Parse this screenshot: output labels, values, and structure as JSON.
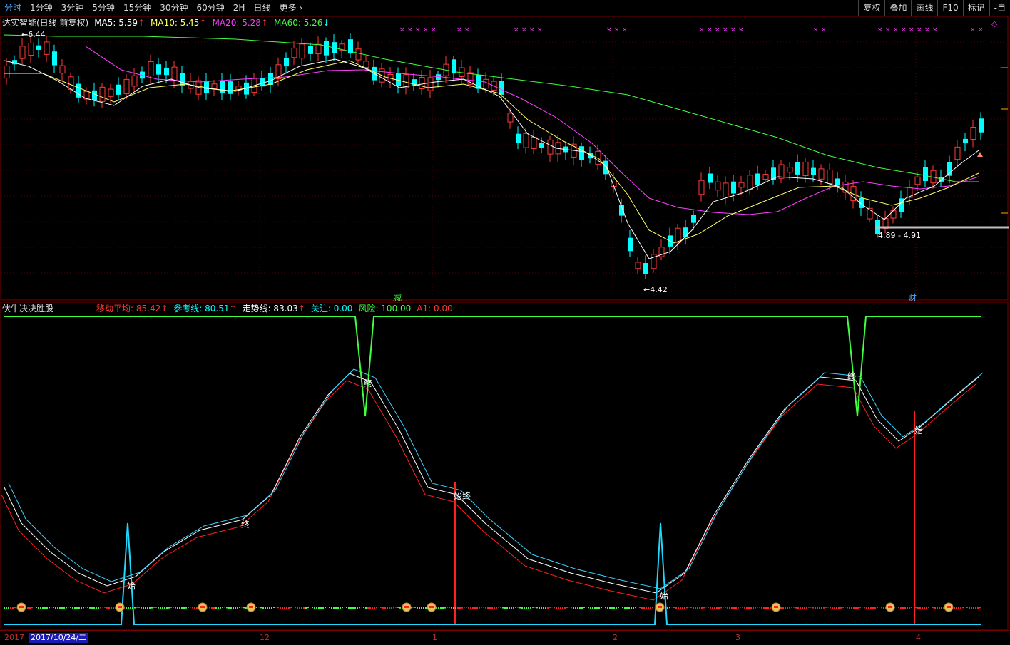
{
  "toolbar": {
    "periods": [
      "分时",
      "1分钟",
      "3分钟",
      "5分钟",
      "15分钟",
      "30分钟",
      "60分钟",
      "2H",
      "日线",
      "更多"
    ],
    "active_period": "分时",
    "more_arrow": "›",
    "right_buttons": [
      "复权",
      "叠加",
      "画线",
      "F10",
      "标记",
      "-自"
    ]
  },
  "main_info": {
    "title": "达实智能(日线 前复权)",
    "ma5": "MA5: 5.59",
    "ma10": "MA10: 5.45",
    "ma20": "MA20: 5.28",
    "ma60": "MA60: 5.26",
    "up_arrow": "↑",
    "down_arrow": "↓"
  },
  "annotations": {
    "high_label": "6.44",
    "low_label": "4.42",
    "range_label": "4.89 - 4.91",
    "jian_label": "减",
    "cai_label": "财"
  },
  "indicator_info": {
    "name": "伏牛决决胜股",
    "ma": "移动平均: 85.42",
    "ref": "参考线: 80.51",
    "trend": "走势线: 83.03",
    "focus": "关注: 0.00",
    "risk": "风险: 100.00",
    "a1": "A1: 0.00",
    "up_arrow": "↑"
  },
  "signals": {
    "start": "始",
    "end": "终",
    "start_end": "始终"
  },
  "date_axis": {
    "cursor": "2017/10/24/二",
    "left_cut": "2017",
    "ticks": [
      "12",
      "1",
      "2",
      "3",
      "4"
    ]
  },
  "colors": {
    "up": "#ff3a3a",
    "down": "#00ffff",
    "ma5": "#ffffff",
    "ma10": "#ffff66",
    "ma20": "#ff40ff",
    "ma60": "#40ff40",
    "bg": "#000000",
    "grid": "#7a0000"
  }
}
